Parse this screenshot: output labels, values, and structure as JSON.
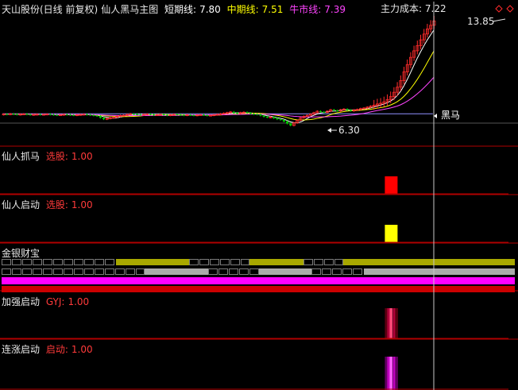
{
  "colors": {
    "background": "#000000",
    "divider": "#b00000",
    "cursor": "#c8c8c8",
    "up": "#ff2b2b",
    "down": "#00c800",
    "label": "#e8e8e8",
    "value_red": "#ff3a3a",
    "value_white": "#e8e8e8",
    "short_line": "#ffffff",
    "mid_line": "#ffff00",
    "bull_line": "#ff44ff",
    "cost_line": "#9090ff",
    "signal_red": "#ff0000",
    "signal_yellow": "#ffff00",
    "gold_olive": "#a8a800",
    "gray_bar": "#aaaaaa",
    "magenta": "#ff00ff",
    "dark_red": "#cc0000"
  },
  "main_panel": {
    "name": "仙人黑马主图",
    "stock": "天山股份(日线 前复权)",
    "items": [
      {
        "label": "短期线:",
        "value": "7.80",
        "color": "#ffffff"
      },
      {
        "label": "中期线:",
        "value": "7.51",
        "color": "#ffff00"
      },
      {
        "label": "牛市线:",
        "value": "7.39",
        "color": "#ff44ff"
      }
    ],
    "cost_label": "主力成本:",
    "cost_value": "7.22",
    "high_label": "13.85",
    "low_label": "6.30",
    "horse_label": "黑马",
    "icons": [
      "diamond-icon",
      "diamond-icon"
    ]
  },
  "panel2": {
    "title": "仙人抓马",
    "label": "选股:",
    "value": "1.00"
  },
  "panel3": {
    "title": "仙人启动",
    "label": "选股:",
    "value": "1.00"
  },
  "panel4": {
    "title": "金银财宝"
  },
  "panel5": {
    "title": "加强启动",
    "label": "GYJ:",
    "value": "1.00"
  },
  "panel6": {
    "title": "连涨启动",
    "label": "启动:",
    "value": "1.00"
  },
  "chart_data": {
    "type": "candlestick",
    "series": [
      {
        "name": "短期线",
        "value": 7.8
      },
      {
        "name": "中期线",
        "value": 7.51
      },
      {
        "name": "牛市线",
        "value": 7.39
      },
      {
        "name": "主力成本",
        "value": 7.22
      }
    ],
    "annotations": {
      "high": 13.85,
      "low": 6.3
    },
    "ylim": [
      5.0,
      14.6
    ],
    "n_bars": 130,
    "closes": [
      7.2,
      7.18,
      7.22,
      7.2,
      7.17,
      7.19,
      7.21,
      7.18,
      7.15,
      7.17,
      7.19,
      7.16,
      7.18,
      7.2,
      7.17,
      7.15,
      7.13,
      7.15,
      7.18,
      7.16,
      7.14,
      7.12,
      7.15,
      7.17,
      7.19,
      7.16,
      7.13,
      7.1,
      7.08,
      6.95,
      6.85,
      6.9,
      6.95,
      6.98,
      7.05,
      7.1,
      7.12,
      7.18,
      7.22,
      7.2,
      7.17,
      7.15,
      7.18,
      7.2,
      7.17,
      7.14,
      7.16,
      7.18,
      7.15,
      7.12,
      7.15,
      7.18,
      7.16,
      7.14,
      7.12,
      7.15,
      7.13,
      7.11,
      7.14,
      7.16,
      7.13,
      7.1,
      7.12,
      7.15,
      7.18,
      7.22,
      7.26,
      7.3,
      7.35,
      7.28,
      7.24,
      7.3,
      7.33,
      7.28,
      7.22,
      7.2,
      7.18,
      7.1,
      7.02,
      6.98,
      7.0,
      6.92,
      6.85,
      6.8,
      6.7,
      6.55,
      6.42,
      6.6,
      6.78,
      6.95,
      7.05,
      7.12,
      7.2,
      7.3,
      7.4,
      7.35,
      7.32,
      7.4,
      7.5,
      7.45,
      7.42,
      7.5,
      7.55,
      7.48,
      7.42,
      7.48,
      7.52,
      7.58,
      7.62,
      7.68,
      7.75,
      7.82,
      7.9,
      7.95,
      8.05,
      8.2,
      8.4,
      8.7,
      9.05,
      9.5,
      10.1,
      10.6,
      11.1,
      11.55,
      11.9,
      12.3,
      12.7,
      13.05,
      13.3,
      13.6
    ],
    "signals": {
      "仙人抓马": {
        "bar": 117,
        "value": 1.0
      },
      "仙人启动": {
        "bar": 117,
        "value": 1.0
      },
      "加强启动": {
        "bar": 117,
        "value": 1.0
      },
      "连涨启动": {
        "bar": 117,
        "value": 1.0
      }
    }
  }
}
